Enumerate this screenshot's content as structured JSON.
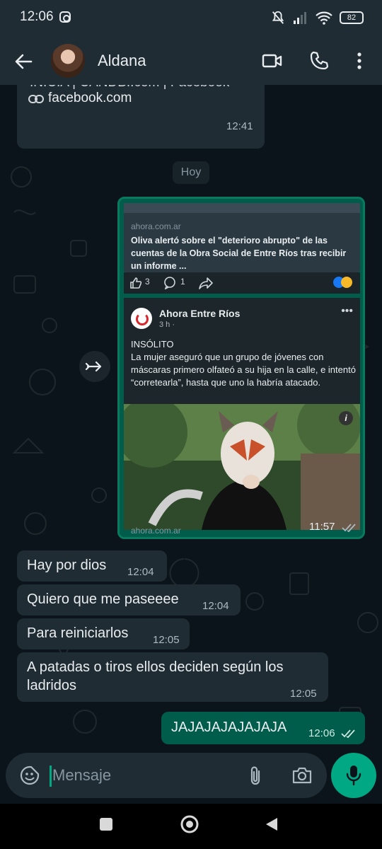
{
  "status_bar": {
    "time": "12:06",
    "battery": "82"
  },
  "header": {
    "contact_name": "Aldana"
  },
  "messages": {
    "prev": {
      "partial_text": "INICIA | CANDBI.com | Facebook",
      "link": "facebook.com",
      "time": "12:41"
    },
    "date_chip": "Hoy",
    "forwarded": {
      "link_source": "ahora.com.ar",
      "headline": "Oliva alertó sobre el \"deterioro abrupto\" de las cuentas de la Obra Social de Entre Ríos tras recibir un informe ...",
      "likes": "3",
      "comments": "1",
      "page_name": "Ahora Entre Ríos",
      "post_age": "3 h ·",
      "post_title": "INSÓLITO",
      "post_body": "La mujer aseguró que un grupo de jóvenes con máscaras primero olfateó a su hija en la calle, e intentó “corretearla”, hasta que uno la habría atacado.",
      "footer_source": "ahora.com.ar",
      "time": "11:57"
    },
    "incoming": [
      {
        "text": "Hay por dios",
        "time": "12:04"
      },
      {
        "text": "Quiero que me paseeee",
        "time": "12:04"
      },
      {
        "text": "Para reiniciarlos",
        "time": "12:05"
      },
      {
        "text": "A patadas o tiros ellos deciden según los",
        "text_line2": "ladridos",
        "time": "12:05"
      }
    ],
    "outgoing": {
      "text": "JAJAJAJAJAJAJA",
      "time": "12:06"
    }
  },
  "input": {
    "placeholder": "Mensaje",
    "value": ""
  },
  "colors": {
    "background": "#0b141a",
    "incoming_bubble": "#202c33",
    "outgoing_bubble": "#005c4b",
    "accent": "#00a884"
  }
}
